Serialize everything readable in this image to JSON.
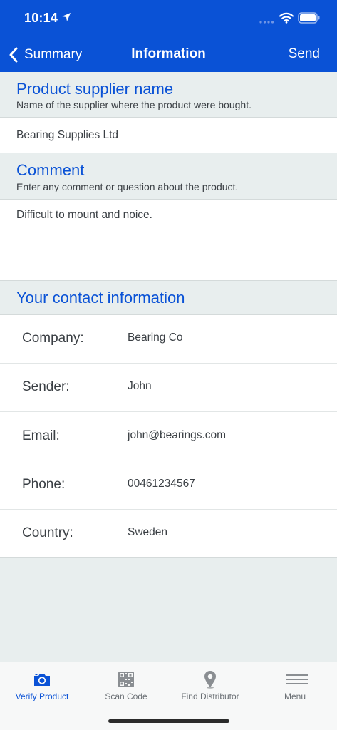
{
  "status_bar": {
    "time": "10:14"
  },
  "nav": {
    "back_label": "Summary",
    "title": "Information",
    "action_label": "Send"
  },
  "supplier": {
    "title": "Product supplier name",
    "subtitle": "Name of the supplier where the product were bought.",
    "value": "Bearing Supplies Ltd"
  },
  "comment": {
    "title": "Comment",
    "subtitle": "Enter any comment or question about the product.",
    "value": "Difficult to mount and noice."
  },
  "contact": {
    "title": "Your contact information",
    "rows": [
      {
        "label": "Company:",
        "value": "Bearing Co"
      },
      {
        "label": "Sender:",
        "value": "John"
      },
      {
        "label": "Email:",
        "value": "john@bearings.com"
      },
      {
        "label": "Phone:",
        "value": "00461234567"
      },
      {
        "label": "Country:",
        "value": "Sweden"
      }
    ]
  },
  "tabs": [
    {
      "label": "Verify Product",
      "icon": "camera-icon",
      "active": true
    },
    {
      "label": "Scan Code",
      "icon": "qr-code-icon",
      "active": false
    },
    {
      "label": "Find Distributor",
      "icon": "map-pin-icon",
      "active": false
    },
    {
      "label": "Menu",
      "icon": "hamburger-menu-icon",
      "active": false
    }
  ],
  "colors": {
    "accent": "#0a52d6",
    "background": "#e8eeee",
    "text": "#3a3f44"
  }
}
